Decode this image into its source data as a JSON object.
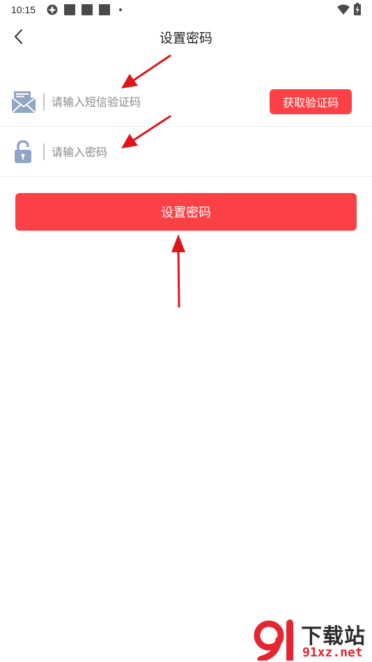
{
  "status_bar": {
    "time": "10:15"
  },
  "header": {
    "title": "设置密码",
    "back_icon": "chevron-left-icon"
  },
  "form": {
    "sms_code": {
      "icon": "envelope-icon",
      "placeholder": "请输入短信验证码",
      "value": "",
      "get_code_label": "获取验证码"
    },
    "password": {
      "icon": "lock-icon",
      "placeholder": "请输入密码",
      "value": ""
    },
    "submit_label": "设置密码"
  },
  "watermark": {
    "title": "下载站",
    "url": "91xz.net"
  },
  "colors": {
    "accent": "#fb4146",
    "annotation_arrow": "#e0141b",
    "icon_blue": "#90a6c4"
  }
}
